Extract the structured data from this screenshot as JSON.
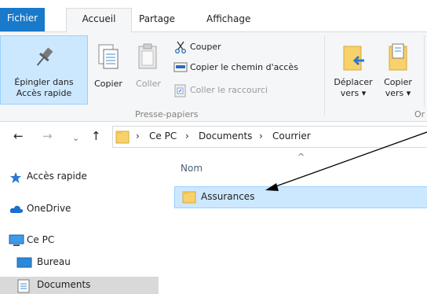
{
  "ribbon": {
    "tabs": [
      {
        "label": "Fichier"
      },
      {
        "label": "Accueil"
      },
      {
        "label": "Partage"
      },
      {
        "label": "Affichage"
      }
    ],
    "pin": {
      "line1": "Épingler dans",
      "line2": "Accès rapide"
    },
    "copy": "Copier",
    "paste": "Coller",
    "cut": "Couper",
    "copy_path": "Copier le chemin d'accès",
    "paste_shortcut": "Coller le raccourci",
    "group_clipboard": "Presse-papiers",
    "move": {
      "line1": "Déplacer",
      "line2": "vers ▾"
    },
    "copyto": {
      "line1": "Copier",
      "line2": "vers ▾"
    },
    "group_organize_partial": "Or"
  },
  "address": {
    "crumbs": [
      "Ce PC",
      "Documents",
      "Courrier"
    ]
  },
  "nav": {
    "items": [
      {
        "label": "Accès rapide"
      },
      {
        "label": "OneDrive"
      },
      {
        "label": "Ce PC"
      },
      {
        "label": "Bureau"
      },
      {
        "label": "Documents"
      }
    ]
  },
  "filelist": {
    "column_name": "Nom",
    "rows": [
      {
        "name": "Assurances"
      }
    ]
  },
  "colors": {
    "accent": "#1979ca",
    "selection": "#cce8ff",
    "selection_border": "#99d1ff",
    "folder": "#f8d16a"
  }
}
